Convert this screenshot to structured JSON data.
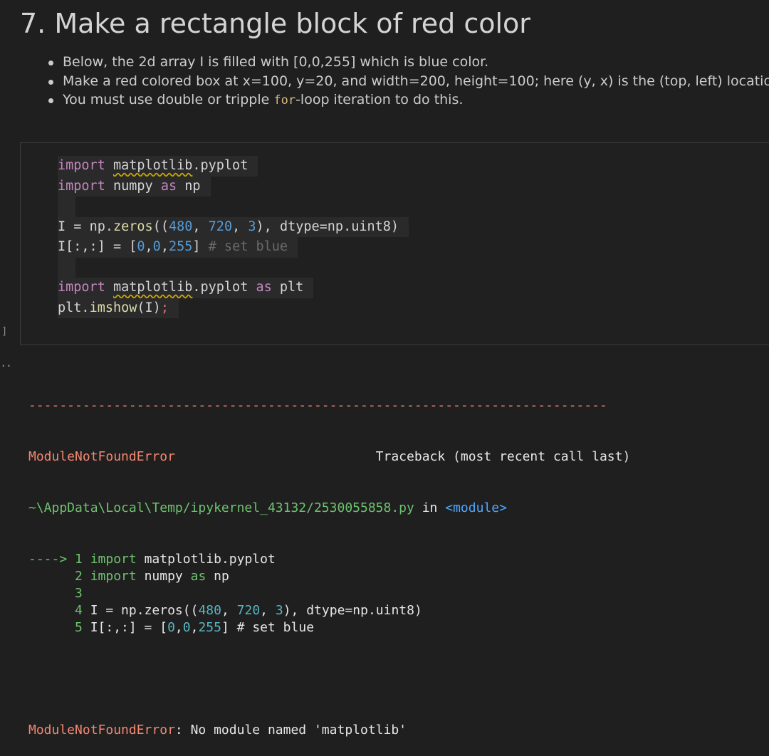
{
  "markdown": {
    "title": "7. Make a rectangle block of red color",
    "bullets": [
      {
        "text": "Below, the 2d array  I  is filled with [0,0,255] which is blue color."
      },
      {
        "text": "Make a red colored box at x=100, y=20, and width=200, height=100; here (y, x) is the (top, left) location of the red b"
      },
      {
        "pre": "You must use double or tripple ",
        "code": "for",
        "post": "-loop iteration to do this."
      }
    ]
  },
  "cell": {
    "execution_count": "]",
    "code_lines": [
      "import matplotlib.pyplot",
      "import numpy as np",
      "",
      "I = np.zeros((480, 720, 3), dtype=np.uint8)",
      "I[:,:] = [0,0,255] # set blue",
      "",
      "import matplotlib.pyplot as plt",
      "plt.imshow(I);"
    ]
  },
  "output": {
    "dots": "..",
    "separator": "---------------------------------------------------------------------------",
    "error_name": "ModuleNotFoundError",
    "traceback_label": "Traceback (most recent call last)",
    "file_path": "~\\AppData\\Local\\Temp/ipykernel_43132/2530055858.py",
    "in_word": "in",
    "module_tag": "<module>",
    "arrow": "---->",
    "trace_lines": [
      {
        "n": "1",
        "code": "import matplotlib.pyplot"
      },
      {
        "n": "2",
        "code": "import numpy as np"
      },
      {
        "n": "3",
        "code": ""
      },
      {
        "n": "4",
        "code": "I = np.zeros((480, 720, 3), dtype=np.uint8)"
      },
      {
        "n": "5",
        "code": "I[:,:] = [0,0,255] # set blue"
      }
    ],
    "final_error_name": "ModuleNotFoundError",
    "final_error_msg": ": No module named 'matplotlib'"
  },
  "colors": {
    "background": "#1f1f1f",
    "error": "#f48771",
    "keyword": "#c586c0",
    "number": "#b5cea8"
  }
}
